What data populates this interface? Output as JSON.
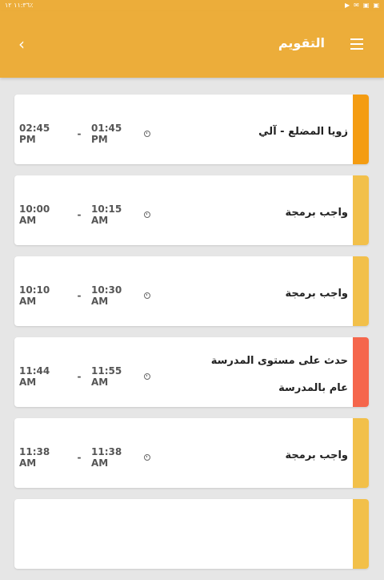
{
  "statusbar": {
    "time": "١١:٣٦",
    "battery": "١٢٪",
    "icons_right": [
      "play-icon",
      "mail-icon",
      "image-icon",
      "image-icon"
    ]
  },
  "appbar": {
    "title": "التقويم",
    "back_icon": "chevron-left-icon",
    "menu_icon": "hamburger-icon"
  },
  "colors": {
    "appbar": "#ecad3a",
    "orange": "#f49c12",
    "yellow": "#f2c04a",
    "red": "#f5664c"
  },
  "events": [
    {
      "title": "زويا المضلع - آلي",
      "subtitle": "",
      "start": "01:45 PM",
      "end": "02:45 PM",
      "color": "#f49c12"
    },
    {
      "title": "واجب برمجة",
      "subtitle": "",
      "start": "10:15 AM",
      "end": "10:00 AM",
      "color": "#f2c04a"
    },
    {
      "title": "واجب برمجة",
      "subtitle": "",
      "start": "10:30 AM",
      "end": "10:10 AM",
      "color": "#f2c04a"
    },
    {
      "title": "حدث على مستوى المدرسة",
      "subtitle": "عام بالمدرسة",
      "start": "11:55 AM",
      "end": "11:44 AM",
      "color": "#f5664c"
    },
    {
      "title": "واجب برمجة",
      "subtitle": "",
      "start": "11:38 AM",
      "end": "11:38 AM",
      "color": "#f2c04a"
    },
    {
      "title": "",
      "subtitle": "",
      "start": "",
      "end": "",
      "color": "#f2c04a"
    }
  ]
}
